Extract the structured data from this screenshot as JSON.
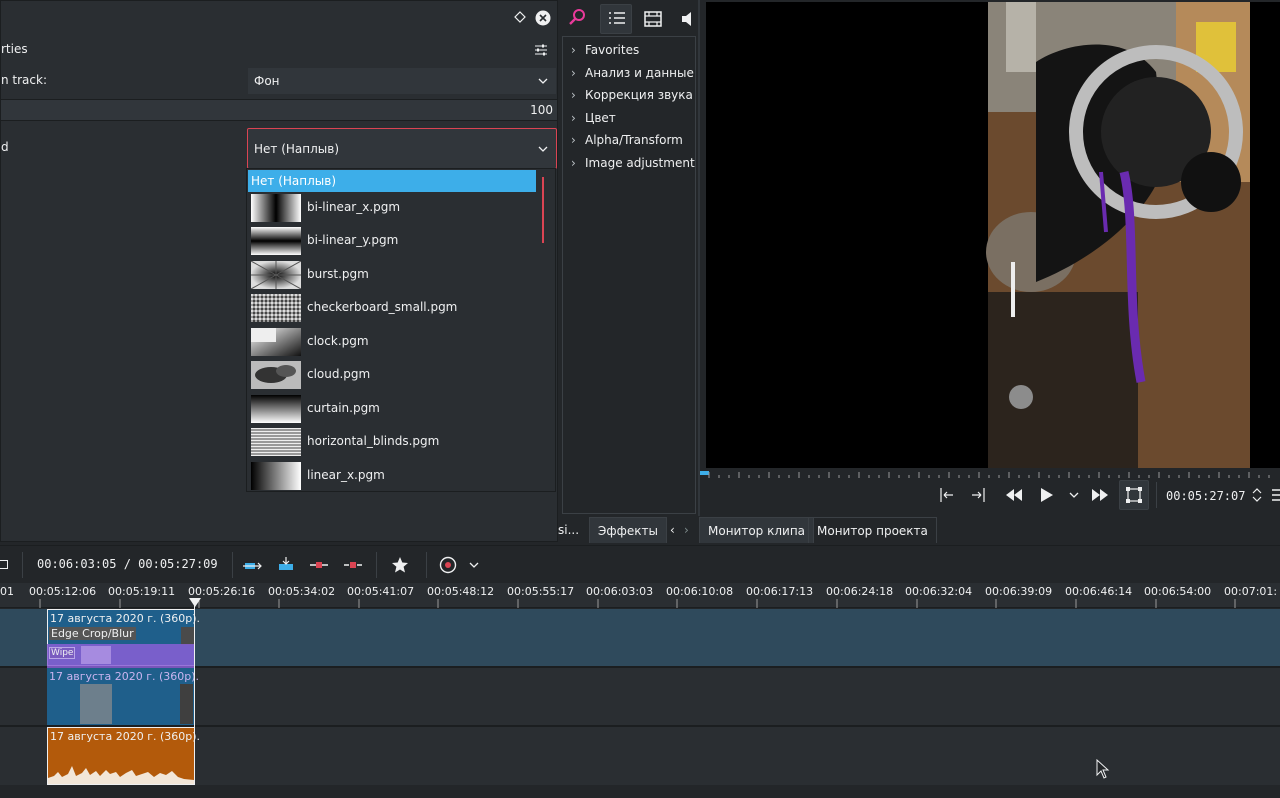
{
  "properties": {
    "header_partial": "rties",
    "track_label_partial": "n track:",
    "track_value": "Фон",
    "opacity_value": "100",
    "wipe_label_partial": "d",
    "wipe_value": "Нет (Наплыв)"
  },
  "wipe_list": {
    "selected": "Нет (Наплыв)",
    "items": [
      {
        "label": "bi-linear_x.pgm",
        "thumb": "bilinear-x"
      },
      {
        "label": "bi-linear_y.pgm",
        "thumb": "bilinear-y"
      },
      {
        "label": "burst.pgm",
        "thumb": "burst"
      },
      {
        "label": "checkerboard_small.pgm",
        "thumb": "noise"
      },
      {
        "label": "clock.pgm",
        "thumb": "clock"
      },
      {
        "label": "cloud.pgm",
        "thumb": "cloud"
      },
      {
        "label": "curtain.pgm",
        "thumb": "curtain"
      },
      {
        "label": "horizontal_blinds.pgm",
        "thumb": "blinds"
      },
      {
        "label": "linear_x.pgm",
        "thumb": "linear-x"
      }
    ]
  },
  "effects": {
    "tree": [
      "Favorites",
      "Анализ и данные",
      "Коррекция звука",
      "Цвет",
      "Alpha/Transform",
      "Image adjustment"
    ]
  },
  "tabs": {
    "left_partial": "si...",
    "effects": "Эффекты",
    "clip_monitor": "Монитор клипа",
    "project_monitor": "Монитор проекта"
  },
  "monitor": {
    "timecode": "00:05:27:07"
  },
  "timeline": {
    "position": "00:06:03:05 / 00:05:27:09",
    "ruler": [
      "01",
      "00:05:12:06",
      "00:05:19:11",
      "00:05:26:16",
      "00:05:34:02",
      "00:05:41:07",
      "00:05:48:12",
      "00:05:55:17",
      "00:06:03:03",
      "00:06:10:08",
      "00:06:17:13",
      "00:06:24:18",
      "00:06:32:04",
      "00:06:39:09",
      "00:06:46:14",
      "00:06:54:00",
      "00:07:01:"
    ],
    "clips": {
      "video_title": "17 августа 2020 г. (360р).",
      "effect_label": "Edge Crop/Blur",
      "composition_label": "Wipe",
      "video2_title": "17 августа 2020 г. (360р).",
      "audio_title": "17 августа 2020 г. (360р)."
    }
  },
  "colors": {
    "accent": "#3daee9",
    "selection_border": "#da4453",
    "video_track": "#2f4a5c",
    "clip_blue": "#1f5f8b",
    "composition": "#8a5fd6",
    "audio_clip": "#b35a0b"
  }
}
